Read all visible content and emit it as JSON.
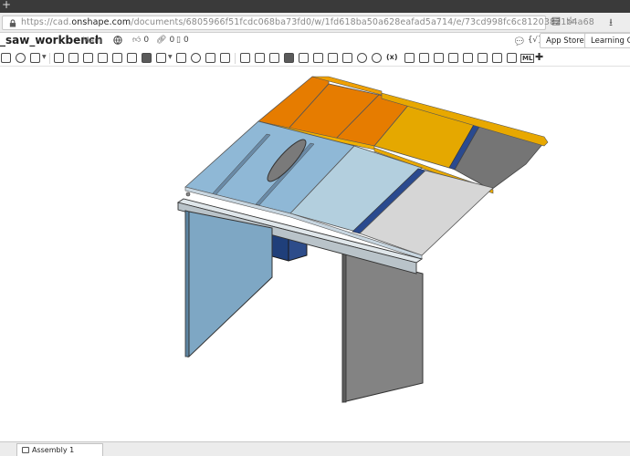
{
  "browser": {
    "url_prefix": "https://cad.",
    "url_domain": "onshape.com",
    "url_rest": "/documents/6805966f51fcdc068ba73fd0/w/1fd618ba50a628eafad5a714/e/73cd998fc6c81203821b4a68",
    "new_tab_glyph": "+",
    "reader_glyph": "▤",
    "bookmark_glyph": "☆",
    "download_glyph": "⭳"
  },
  "document": {
    "title": "_saw_workbench",
    "branch": "Main",
    "likes": "0",
    "links": "0",
    "shares": "0",
    "app_store_label": "App Store",
    "learning_center_label": "Learning Center"
  },
  "toolbar": {
    "fx_label": "(x)",
    "ml_label": "ML"
  },
  "tabs": [
    {
      "label": "Assembly 1"
    }
  ],
  "colors": {
    "orange": "#e67c00",
    "gold": "#e5a800",
    "steel_blue": "#8fb8d6",
    "light_blue": "#b3cfde",
    "navy": "#2a4a8f",
    "gray_panel": "#757575",
    "light_gray": "#d6d6d6",
    "leg_blue": "#7ea7c4",
    "leg_gray": "#838383"
  }
}
